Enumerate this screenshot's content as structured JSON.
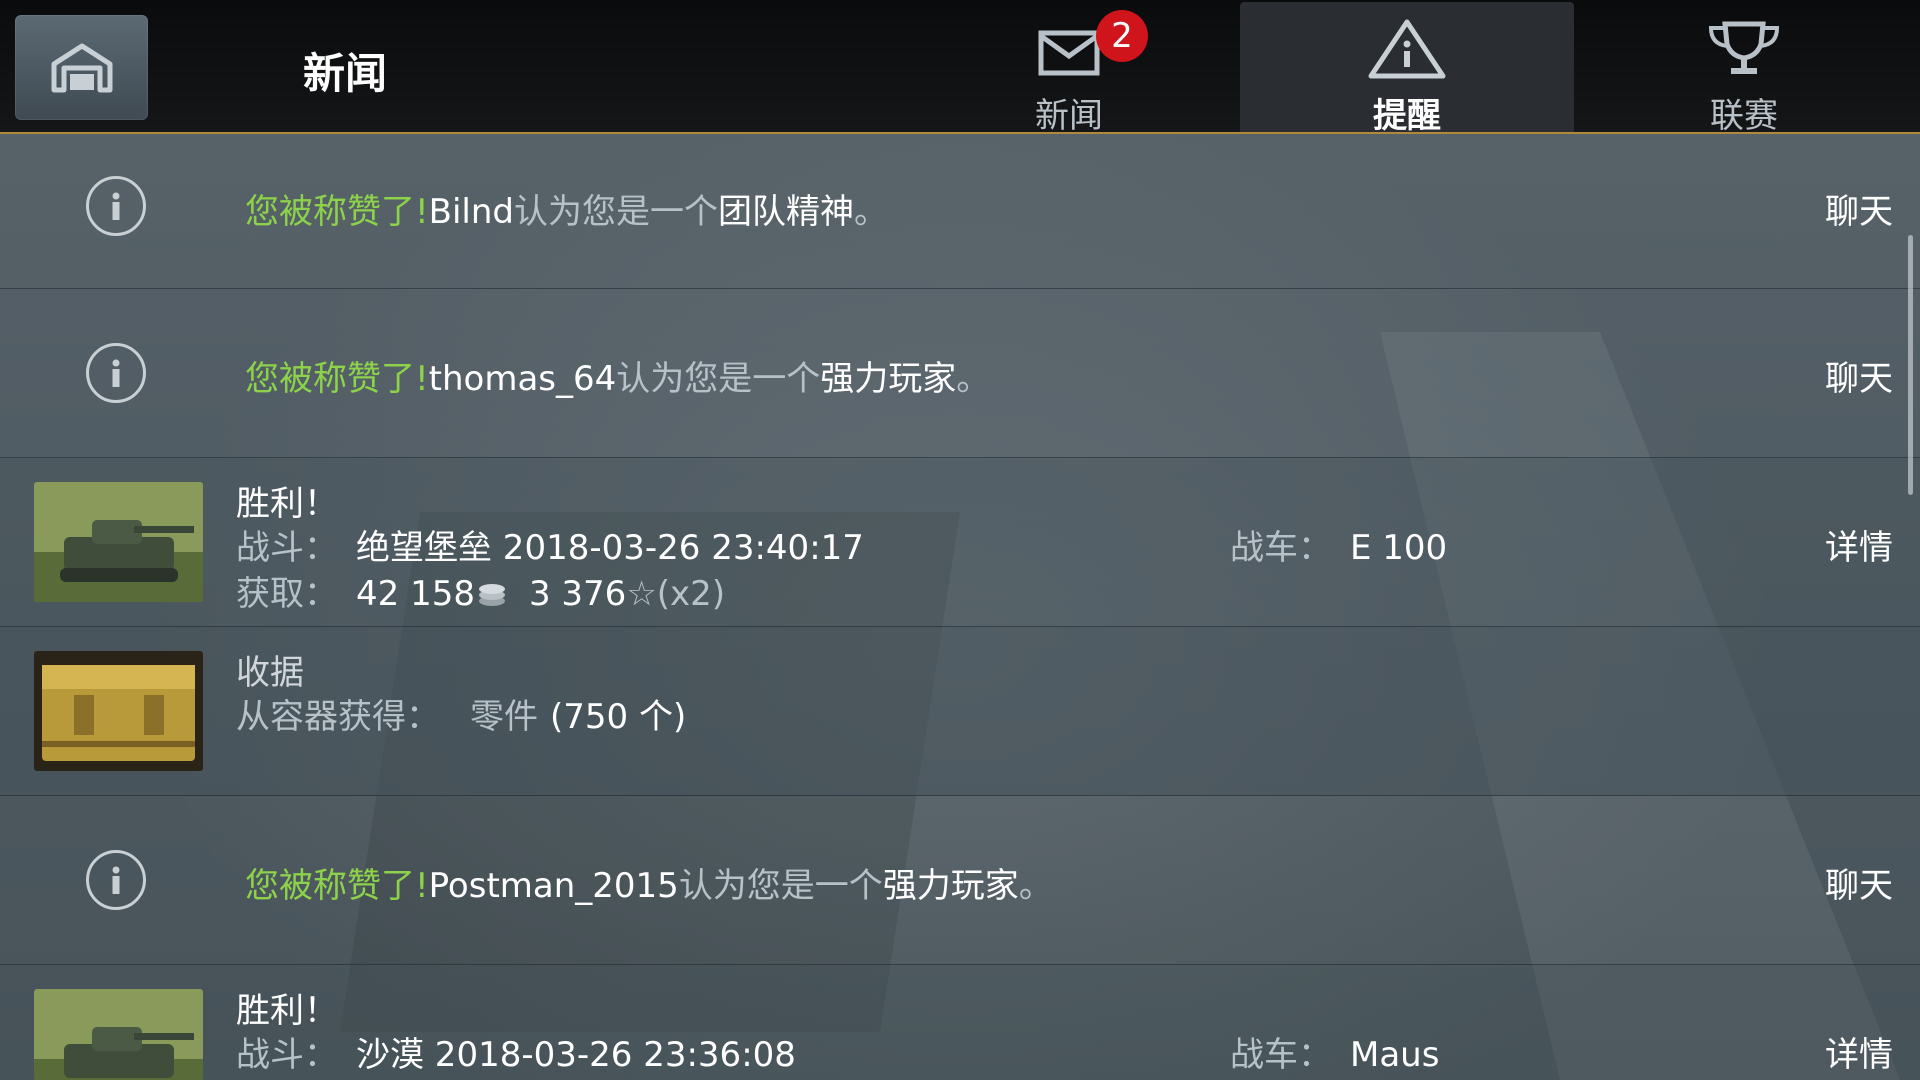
{
  "header": {
    "title": "新闻",
    "tabs": [
      {
        "label": "新闻",
        "badge": "2",
        "icon": "envelope-icon"
      },
      {
        "label": "提醒",
        "icon": "warning-icon",
        "active": true
      },
      {
        "label": "联赛",
        "icon": "trophy-icon"
      }
    ]
  },
  "rows": [
    {
      "prefix": "您被称赞了!",
      "player": "Bilnd",
      "mid": "认为您是一个",
      "trait": "团队精神",
      "end": "。",
      "action": "聊天"
    },
    {
      "prefix": "您被称赞了!",
      "player": "thomas_64",
      "mid": "认为您是一个",
      "trait": "强力玩家",
      "end": "。",
      "action": "聊天"
    },
    {
      "title": "胜利！",
      "battle_label": "战斗：",
      "battle_value": "绝望堡垒 2018-03-26 23:40:17",
      "vehicle_label": "战车：",
      "vehicle_value": "E 100",
      "earned_label": "获取：",
      "credits": "42 158",
      "xp": "3 376",
      "xp_mult": "(x2)",
      "action": "详情"
    },
    {
      "title": "收据",
      "source_label": "从容器获得：",
      "item": "零件",
      "amount": "(750 个)"
    },
    {
      "prefix": "您被称赞了!",
      "player": "Postman_2015",
      "mid": "认为您是一个",
      "trait": "强力玩家",
      "end": "。",
      "action": "聊天"
    },
    {
      "title": "胜利！",
      "battle_label": "战斗：",
      "battle_value": "沙漠 2018-03-26 23:36:08",
      "vehicle_label": "战车：",
      "vehicle_value": "Maus",
      "action": "详情"
    }
  ],
  "colors": {
    "accent": "#b08a3c",
    "praise": "#8cd24a",
    "badge": "#d0141b"
  }
}
